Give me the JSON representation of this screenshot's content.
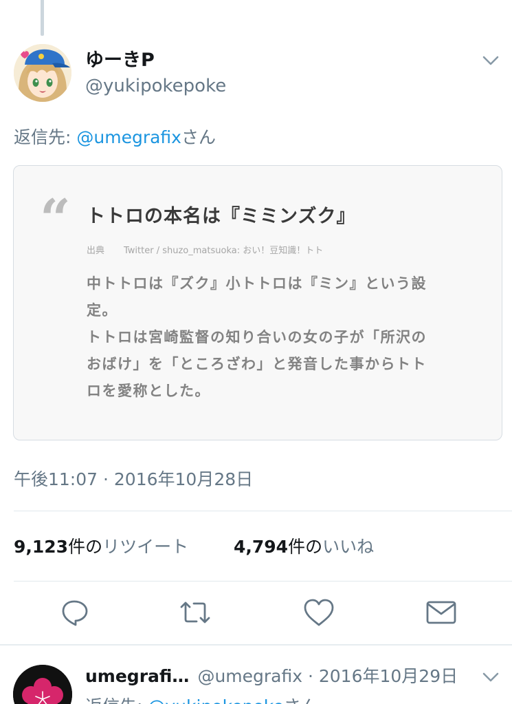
{
  "tweet": {
    "display_name": "ゆーきP",
    "handle": "@yukipokepoke",
    "reply_prefix": "返信先: ",
    "reply_mention": "@umegrafix",
    "reply_suffix": "さん",
    "card": {
      "title": "トトロの本名は『ミミンズク』",
      "source_label": "出典",
      "source_text": "Twitter / shuzo_matsuoka: おい！豆知識！トト",
      "body_lines": [
        "中トトロは『ズク』小トトロは『ミン』という設",
        "定。",
        "トトロは宮崎監督の知り合いの女の子が「所沢の",
        "おばけ」を「ところざわ」と発音した事からトト",
        "ロを愛称とした。"
      ]
    },
    "timestamp": "午後11:07 · 2016年10月28日",
    "retweets": {
      "count": "9,123",
      "unit": "件の",
      "label": "リツイート"
    },
    "likes": {
      "count": "4,794",
      "unit": "件の",
      "label": "いいね"
    },
    "actions": [
      "reply-icon",
      "retweet-icon",
      "like-icon",
      "message-icon"
    ]
  },
  "next_tweet": {
    "display_name": "umegrafi…",
    "meta": "@umegrafix · 2016年10月29日",
    "reply_prefix": "返信先: ",
    "reply_mention": "@yukipokepoke",
    "reply_suffix": "さん"
  },
  "colors": {
    "link": "#1b95e0",
    "secondary": "#657786",
    "primary": "#14171a",
    "divider": "#e1e8ed"
  }
}
